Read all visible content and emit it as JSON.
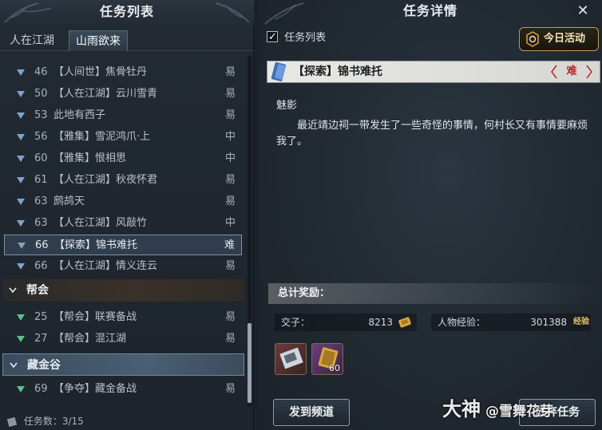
{
  "left": {
    "title": "任务列表",
    "tabs": [
      {
        "label": "人在江湖",
        "active": false
      },
      {
        "label": "山雨欲来",
        "active": true
      }
    ],
    "tasks_main": [
      {
        "level": "46",
        "name": "【人间世】焦骨牡丹",
        "difficulty": "易"
      },
      {
        "level": "50",
        "name": "【人在江湖】云川雪青",
        "difficulty": "易"
      },
      {
        "level": "53",
        "name": "此地有西子",
        "difficulty": "易"
      },
      {
        "level": "56",
        "name": "【雅集】雪泥鸿爪·上",
        "difficulty": "中"
      },
      {
        "level": "60",
        "name": "【雅集】恨相思",
        "difficulty": "中"
      },
      {
        "level": "61",
        "name": "【人在江湖】秋夜怀君",
        "difficulty": "易"
      },
      {
        "level": "63",
        "name": "鹧鸪天",
        "difficulty": "易"
      },
      {
        "level": "63",
        "name": "【人在江湖】风敲竹",
        "difficulty": "中"
      },
      {
        "level": "66",
        "name": "【探索】锦书难托",
        "difficulty": "难",
        "selected": true
      },
      {
        "level": "66",
        "name": "【人在江湖】情义连云",
        "difficulty": "易"
      }
    ],
    "group_guild": {
      "label": "帮会",
      "tasks": [
        {
          "level": "25",
          "name": "【帮会】联赛备战",
          "difficulty": "易"
        },
        {
          "level": "27",
          "name": "【帮会】混江湖",
          "difficulty": "易"
        }
      ]
    },
    "group_cangjin": {
      "label": "藏金谷",
      "tasks": [
        {
          "level": "69",
          "name": "【争夺】藏金备战",
          "difficulty": "易"
        }
      ]
    },
    "task_count": "任务数：3/15"
  },
  "right": {
    "title": "任务详情",
    "close_glyph": "✕",
    "checkbox_label": "任务列表",
    "checkbox_checked": true,
    "daily_button": "今日活动",
    "quest_title": "【探索】锦书难托",
    "difficulty_badge": "难",
    "npc": "魅影",
    "description": "最近靖边祠一带发生了一些奇怪的事情，何村长又有事情要麻烦我了。",
    "reward_header": "总计奖励：",
    "rewards": [
      {
        "label": "交子：",
        "value": "8213",
        "icon": "coin-icon"
      },
      {
        "label": "人物经验：",
        "value": "301388",
        "icon": "exp-badge-icon",
        "badge_text": "经验"
      }
    ],
    "items": [
      {
        "icon": "scroll-item-icon",
        "qty": ""
      },
      {
        "icon": "book-item-icon",
        "qty": "60"
      }
    ],
    "buttons": {
      "send_channel": "发到频道",
      "abandon": "放弃任务"
    },
    "watermark": {
      "big": "大神",
      "text": "@雪舞花芽"
    }
  },
  "colors": {
    "panel_bg": "#1d242c",
    "selected_border": "#7d93a8",
    "difficulty_hard": "#b8262e",
    "chevron_green": "#5fbf8a",
    "chevron_blue": "#7fa3c8",
    "gold": "#d8a742"
  }
}
